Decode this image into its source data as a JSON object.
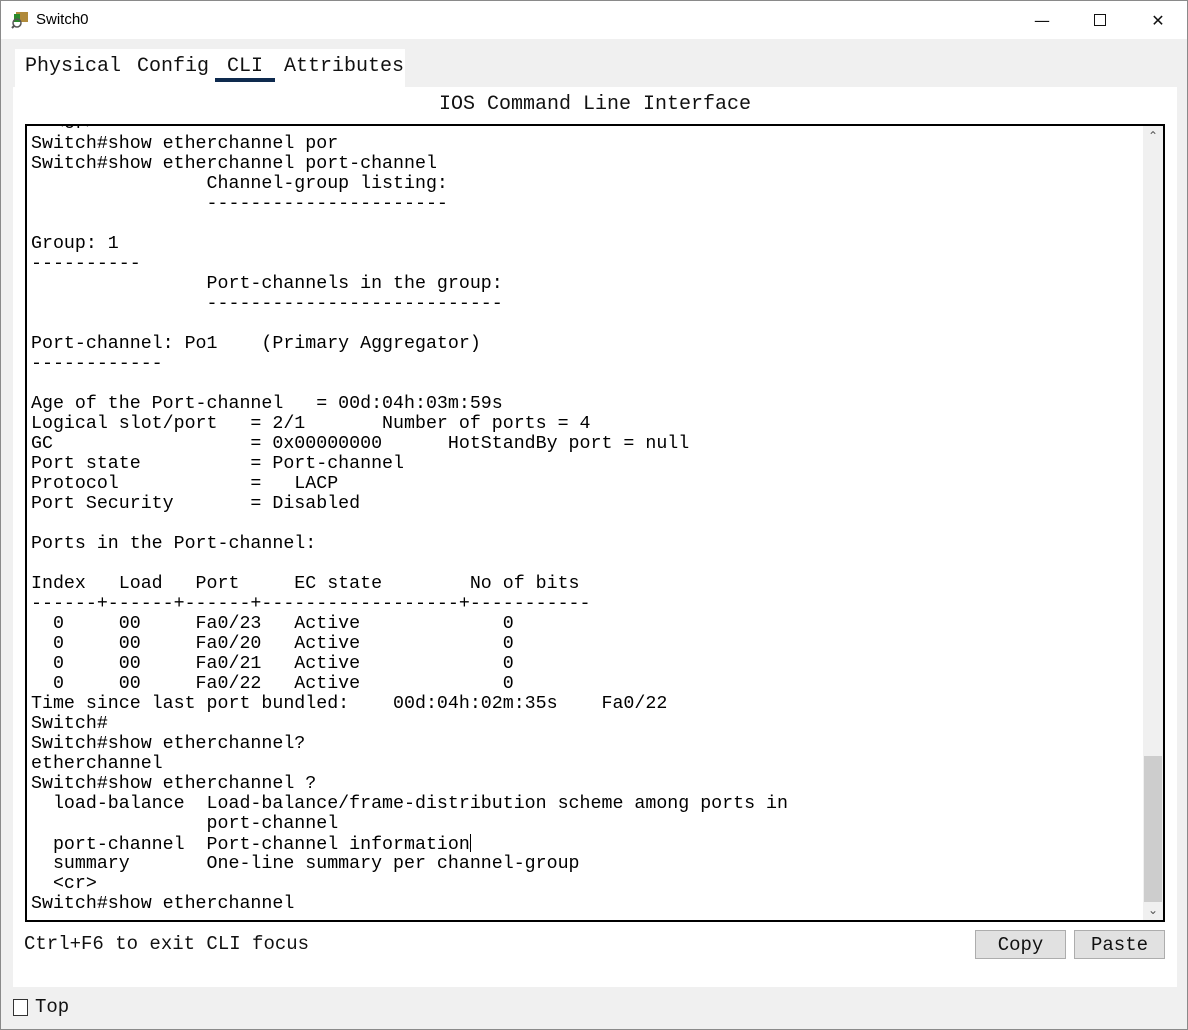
{
  "window": {
    "title": "Switch0",
    "controls": [
      "minimize",
      "maximize",
      "close"
    ]
  },
  "tabs": [
    {
      "label": "Physical",
      "active": false
    },
    {
      "label": "Config",
      "active": false
    },
    {
      "label": "CLI",
      "active": true
    },
    {
      "label": "Attributes",
      "active": false
    }
  ],
  "cli": {
    "title": "IOS Command Line Interface",
    "lines": [
      "  <cr>",
      "Switch#show etherchannel por",
      "Switch#show etherchannel port-channel",
      "                Channel-group listing:",
      "                ----------------------",
      "",
      "Group: 1",
      "----------",
      "                Port-channels in the group:",
      "                ---------------------------",
      "",
      "Port-channel: Po1    (Primary Aggregator)",
      "------------",
      "",
      "Age of the Port-channel   = 00d:04h:03m:59s",
      "Logical slot/port   = 2/1       Number of ports = 4",
      "GC                  = 0x00000000      HotStandBy port = null",
      "Port state          = Port-channel",
      "Protocol            =   LACP",
      "Port Security       = Disabled",
      "",
      "Ports in the Port-channel:",
      "",
      "Index   Load   Port     EC state        No of bits",
      "------+------+------+------------------+-----------",
      "  0     00     Fa0/23   Active             0",
      "  0     00     Fa0/20   Active             0",
      "  0     00     Fa0/21   Active             0",
      "  0     00     Fa0/22   Active             0",
      "Time since last port bundled:    00d:04h:02m:35s    Fa0/22",
      "Switch#",
      "Switch#show etherchannel?",
      "etherchannel",
      "Switch#show etherchannel ?",
      "  load-balance  Load-balance/frame-distribution scheme among ports in",
      "                port-channel",
      "  port-channel  Port-channel information",
      "  summary       One-line summary per channel-group",
      "  <cr>",
      "Switch#show etherchannel"
    ]
  },
  "footer": {
    "hint": "Ctrl+F6 to exit CLI focus",
    "copy_label": "Copy",
    "paste_label": "Paste"
  },
  "top_option": {
    "label": "Top",
    "checked": false
  }
}
